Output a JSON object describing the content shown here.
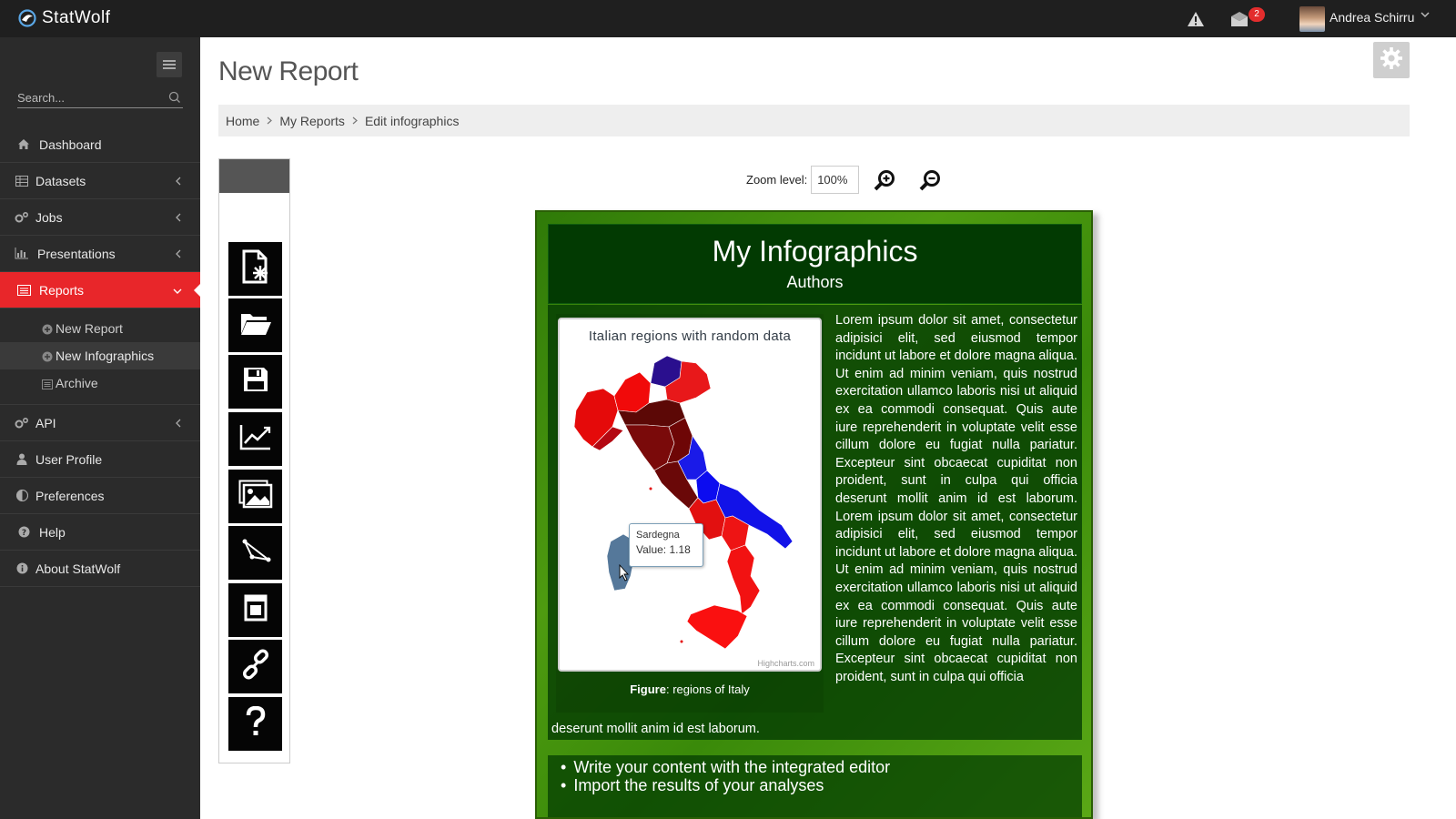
{
  "app": {
    "name": "StatWolf"
  },
  "topbar": {
    "notification_count": "2",
    "user_name": "Andrea Schirru",
    "icons": [
      "warning-icon",
      "messages-icon",
      "chevron-down-icon"
    ]
  },
  "sidebar": {
    "search_placeholder": "Search...",
    "items": [
      {
        "label": "Dashboard",
        "icon": "home-icon"
      },
      {
        "label": "Datasets",
        "icon": "table-icon"
      },
      {
        "label": "Jobs",
        "icon": "cogs-icon"
      },
      {
        "label": "Presentations",
        "icon": "bar-chart-icon"
      },
      {
        "label": "Reports",
        "icon": "list-alt-icon"
      },
      {
        "label": "API",
        "icon": "cogs-icon"
      },
      {
        "label": "User Profile",
        "icon": "user-icon"
      },
      {
        "label": "Preferences",
        "icon": "adjust-icon"
      },
      {
        "label": "Help",
        "icon": "question-icon"
      },
      {
        "label": "About StatWolf",
        "icon": "info-icon"
      }
    ],
    "reports_sub": [
      {
        "label": "New Report",
        "icon": "plus-circle-icon"
      },
      {
        "label": "New Infographics",
        "icon": "plus-circle-icon"
      },
      {
        "label": "Archive",
        "icon": "archive-icon"
      }
    ]
  },
  "main": {
    "title": "New Report",
    "breadcrumb": [
      "Home",
      "My Reports",
      "Edit infographics"
    ]
  },
  "toolbar": {
    "tools": [
      "new-document-icon",
      "open-folder-icon",
      "save-icon",
      "line-chart-icon",
      "image-icon",
      "shape-icon",
      "layout-icon",
      "link-icon",
      "help-icon"
    ]
  },
  "zoom": {
    "label": "Zoom level:",
    "value": "100%"
  },
  "infographic": {
    "title": "My Infographics",
    "subtitle": "Authors",
    "map_title": "Italian regions with random data",
    "credits": "Highcharts.com",
    "tooltip_region": "Sardegna",
    "tooltip_value": "Value: 1.18",
    "caption_bold": "Figure",
    "caption_text": ": regions of Italy",
    "lorem": "Lorem ipsum dolor sit amet, consectetur adipisici elit, sed eiusmod tempor incidunt ut labore et dolore magna aliqua. Ut enim ad minim veniam, quis nostrud exercitation ullamco laboris nisi ut aliquid ex ea commodi consequat. Quis aute iure reprehenderit in voluptate velit esse cillum dolore eu fugiat nulla pariatur. Excepteur sint obcaecat cupiditat non proident, sunt in culpa qui officia deserunt mollit anim id est laborum. Lorem ipsum dolor sit amet, consectetur adipisici elit, sed eiusmod tempor incidunt ut labore et dolore magna aliqua. Ut enim ad minim veniam, quis nostrud exercitation ullamco laboris nisi ut aliquid ex ea commodi consequat. Quis aute iure reprehenderit in voluptate velit esse cillum dolore eu fugiat nulla pariatur. Excepteur sint obcaecat cupiditat non proident, sunt in culpa qui officia",
    "lorem_tail": "deserunt mollit anim id est laborum.",
    "bullets": [
      "Write your content with the integrated editor",
      "Import the results of your analyses"
    ]
  },
  "colors": {
    "accent": "#e8262a",
    "sidebar_bg": "#2b2b2b",
    "topbar_bg": "#1f1f1f",
    "canvas_green": "#3a8a0a",
    "panel_dark_green": "#023a02"
  }
}
